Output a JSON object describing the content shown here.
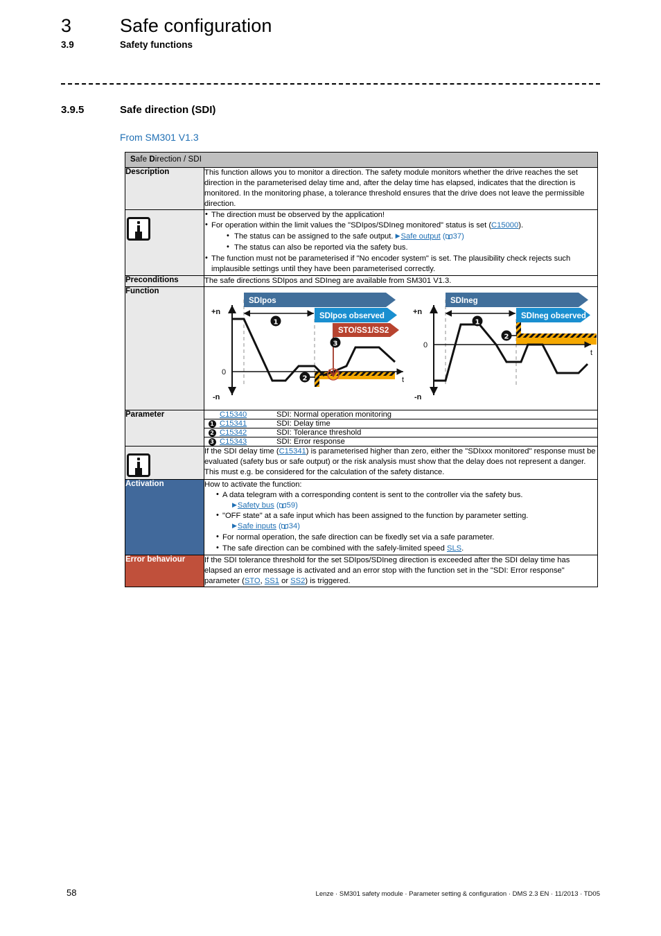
{
  "header": {
    "chapter_number": "3",
    "chapter_title": "Safe configuration",
    "section_number": "3.9",
    "section_title": "Safety functions"
  },
  "section": {
    "number": "3.9.5",
    "title": "Safe direction (SDI)",
    "availability_note": "From SM301 V1.3"
  },
  "table": {
    "title_prefix": "S",
    "title": "Safe Direction / SDI",
    "title_parts": {
      "a": "S",
      "b": "afe ",
      "c": "D",
      "d": "irection / SDI"
    },
    "rows": {
      "description": {
        "label": "Description",
        "text": "This function allows you to monitor a direction. The safety module monitors whether the drive reaches the set direction in the parameterised delay time and, after the delay time has elapsed, indicates that the direction is monitored. In the monitoring phase, a tolerance threshold ensures that the drive does not leave the permissible direction."
      },
      "note1": {
        "icon": "info-icon",
        "bullet1": "The direction must be observed by the application!",
        "bullet2_pre": "For operation within the limit values the \"SDIpos/SDIneg monitored\" status is set  (",
        "bullet2_link": "C15000",
        "bullet2_post": ").",
        "sub1_pre": "The status can be assigned to the safe output.",
        "sub1_link": "Safe output",
        "sub1_page": "37",
        "sub2": "The status can also be reported via the safety bus.",
        "bullet3": "The function must not be parameterised if \"No encoder system\" is set. The plausibility check rejects such implausible settings until they have been parameterised correctly."
      },
      "preconditions": {
        "label": "Preconditions",
        "text": "The safe directions SDIpos and SDIneg are available from SM301 V1.3."
      },
      "function": {
        "label": "Function"
      },
      "parameter": {
        "label": "Parameter",
        "items": [
          {
            "marker": "",
            "code": "C15340",
            "desc": "SDI: Normal operation monitoring"
          },
          {
            "marker": "1",
            "code": "C15341",
            "desc": "SDI: Delay time"
          },
          {
            "marker": "2",
            "code": "C15342",
            "desc": "SDI: Tolerance threshold"
          },
          {
            "marker": "3",
            "code": "C15343",
            "desc": "SDI: Error response"
          }
        ]
      },
      "note2": {
        "icon": "info-icon",
        "pre": "If the SDI delay time (",
        "link": "C15341",
        "post": ") is parameterised higher than zero, either the \"SDIxxx monitored\" response must be evaluated (safety bus or safe output) or the risk analysis must show that the delay does not represent a danger. This must e.g. be considered for the calculation of the safety distance."
      },
      "activation": {
        "label": "Activation",
        "intro": "How to activate the function:",
        "bullet1": "A data telegram with a corresponding content is sent to the controller via the safety bus.",
        "xref1_link": "Safety bus",
        "xref1_page": "59",
        "bullet2": "\"OFF state\" at a safe input which has been assigned to the function by parameter setting.",
        "xref2_link": "Safe inputs",
        "xref2_page": "34",
        "bullet3": "For normal operation, the safe direction can be fixedly set via a safe parameter.",
        "bullet4_pre": "The safe direction can be combined with the safely-limited speed ",
        "bullet4_link": "SLS",
        "bullet4_post": "."
      },
      "error_behaviour": {
        "label": "Error behaviour",
        "pre": "If the SDI tolerance threshold for the set SDIpos/SDIneg direction is exceeded after the SDI delay time has elapsed an error message is activated and an error stop with the function set in the \"SDI: Error response\" parameter (",
        "link1": "STO",
        "sep1": ", ",
        "link2": "SS1",
        "sep2": " or ",
        "link3": "SS2",
        "post": ") is triggered."
      }
    }
  },
  "figure": {
    "left": {
      "banner_main": "SDIpos",
      "banner_observed": "SDIpos observed",
      "banner_stop": "STO/SS1/SS2",
      "axis_top": "+n",
      "axis_zero": "0",
      "axis_bottom": "-n",
      "axis_time": "t",
      "marker_delay": "1",
      "marker_tolerance": "2",
      "marker_error": "3"
    },
    "right": {
      "banner_main": "SDIneg",
      "banner_observed": "SDIneg observed",
      "axis_top": "+n",
      "axis_zero": "0",
      "axis_bottom": "-n",
      "axis_time": "t",
      "marker_delay": "1",
      "marker_tolerance": "2"
    },
    "colors": {
      "banner_main": "#416f9b",
      "banner_observed": "#1a8fd0",
      "banner_stop": "#b8432f",
      "tolerance_band": "#f5a800",
      "error_line": "#a03526",
      "waveform": "#000000"
    }
  },
  "footer": {
    "page_number": "58",
    "text": "Lenze · SM301 safety module · Parameter setting & configuration · DMS 2.3 EN · 11/2013 · TD05"
  }
}
